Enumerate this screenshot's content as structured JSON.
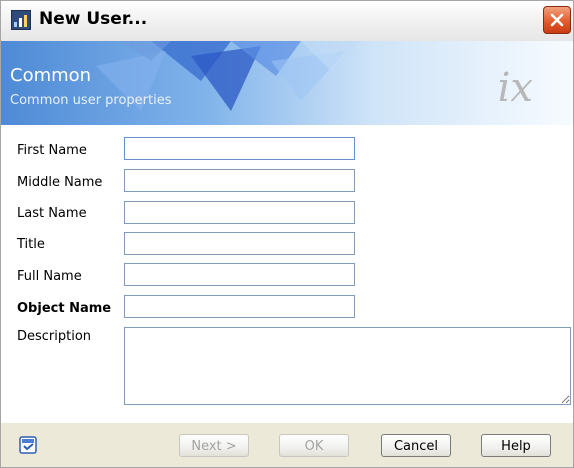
{
  "window": {
    "title": "New User...",
    "icons": {
      "app": "user-window-icon",
      "close": "close-icon"
    }
  },
  "banner": {
    "title": "Common",
    "subtitle": "Common user properties",
    "logo_text": "ix"
  },
  "form": {
    "fields": [
      {
        "label": "First Name",
        "value": ""
      },
      {
        "label": "Middle Name",
        "value": ""
      },
      {
        "label": "Last Name",
        "value": ""
      },
      {
        "label": "Title",
        "value": ""
      },
      {
        "label": "Full Name",
        "value": ""
      },
      {
        "label": "Object Name",
        "value": ""
      }
    ],
    "description": {
      "label": "Description",
      "value": ""
    }
  },
  "footer": {
    "help_icon": "help-topic-icon",
    "buttons": {
      "next": "Next >",
      "ok": "OK",
      "cancel": "Cancel",
      "help": "Help"
    }
  },
  "colors": {
    "banner_accent": "#4e8ad6",
    "field_border": "#7f9db9",
    "close_button": "#e45b2e"
  }
}
